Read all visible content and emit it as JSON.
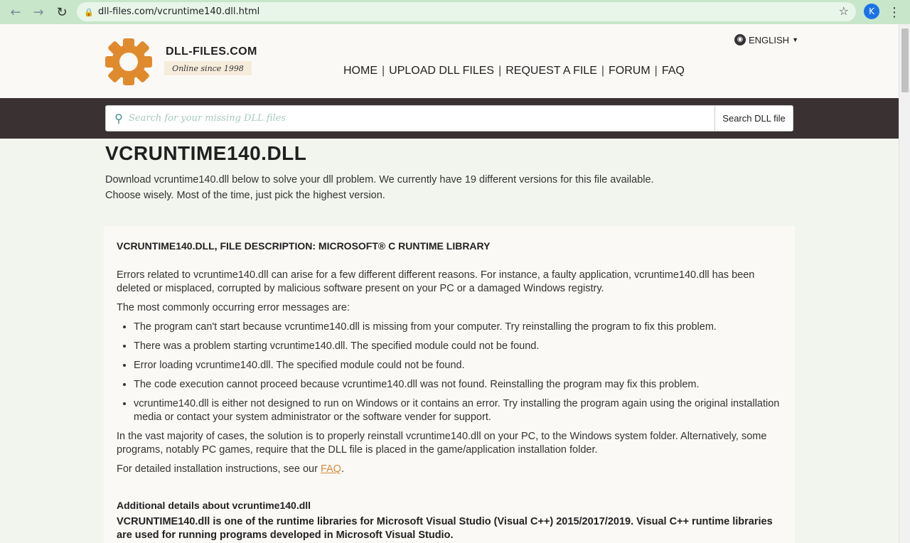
{
  "browser": {
    "url": "dll-files.com/vcruntime140.dll.html",
    "avatar_letter": "K"
  },
  "header": {
    "brand": "DLL-FILES.COM",
    "tagline": "Online since 1998",
    "language": "ENGLISH",
    "nav": [
      "HOME",
      "UPLOAD DLL FILES",
      "REQUEST A FILE",
      "FORUM",
      "FAQ"
    ]
  },
  "search": {
    "placeholder": "Search for your missing DLL files",
    "button_label": "Search DLL file"
  },
  "main": {
    "title": "VCRUNTIME140.DLL",
    "intro_line1": "Download vcruntime140.dll below to solve your dll problem. We currently have 19 different versions for this file available.",
    "intro_line2": "Choose wisely. Most of the time, just pick the highest version."
  },
  "card": {
    "title": "VCRUNTIME140.DLL, FILE DESCRIPTION: MICROSOFT® C RUNTIME LIBRARY",
    "p1": "Errors related to vcruntime140.dll can arise for a few different different reasons. For instance, a faulty application, vcruntime140.dll has been deleted or misplaced, corrupted by malicious software present on your PC or a damaged Windows registry.",
    "p2": "The most commonly occurring error messages are:",
    "errors": [
      "The program can't start because vcruntime140.dll is missing from your computer. Try reinstalling the program to fix this problem.",
      "There was a problem starting vcruntime140.dll. The specified module could not be found.",
      "Error loading vcruntime140.dll. The specified module could not be found.",
      "The code execution cannot proceed because vcruntime140.dll was not found. Reinstalling the program may fix this problem.",
      "vcruntime140.dll is either not designed to run on Windows or it contains an error. Try installing the program again using the original installation media or contact your system administrator or the software vender for support."
    ],
    "p3": "In the vast majority of cases, the solution is to properly reinstall vcruntime140.dll on your PC, to the Windows system folder. Alternatively, some programs, notably PC games, require that the DLL file is placed in the game/application installation folder.",
    "p4_before": "For detailed installation instructions, see our ",
    "p4_link": "FAQ",
    "p4_after": ".",
    "additional_title": "Additional details about vcruntime140.dll",
    "additional_text": "VCRUNTIME140.dll is one of the runtime libraries for Microsoft Visual Studio (Visual C++) 2015/2017/2019. Visual C++ runtime libraries are used for running programs developed in Microsoft Visual Studio."
  },
  "colors": {
    "chrome": "#c8e6c9",
    "search_band": "#3a3232",
    "logo_orange": "#e08a2e",
    "link": "#d98a3a"
  }
}
